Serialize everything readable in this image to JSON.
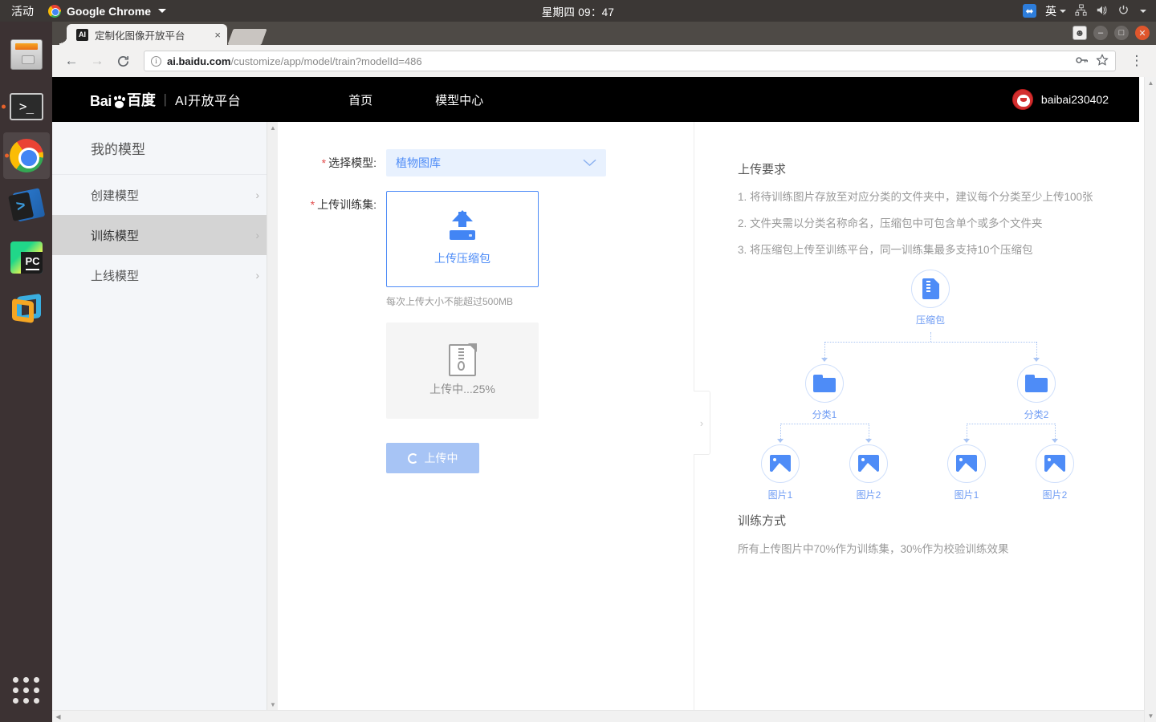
{
  "os_topbar": {
    "activities": "活动",
    "app_name": "Google Chrome",
    "clock": "星期四 09：47",
    "ime": "英",
    "icons": [
      "dropbox-icon",
      "network-icon",
      "volume-muted-icon",
      "power-icon"
    ]
  },
  "dock": {
    "items": [
      {
        "name": "files",
        "icon": "files-icon"
      },
      {
        "name": "terminal",
        "icon": "terminal-icon"
      },
      {
        "name": "chrome",
        "icon": "chrome-icon"
      },
      {
        "name": "vscode",
        "icon": "vscode-icon"
      },
      {
        "name": "pycharm",
        "icon": "pycharm-icon"
      },
      {
        "name": "virtualbox",
        "icon": "virtualbox-icon"
      }
    ],
    "show_apps": "show-applications-icon"
  },
  "browser": {
    "tab": {
      "favicon_text": "AI",
      "title": "定制化图像开放平台",
      "close": "×"
    },
    "url_host": "ai.baidu.com",
    "url_path": "/customize/app/model/train?modelId=486",
    "back": "←",
    "forward": "→",
    "reload": "C",
    "key_icon": "password-key-icon",
    "star_icon": "bookmark-star-icon",
    "menu_icon": "chrome-menu-icon",
    "window_buttons": {
      "minimize": "–",
      "maximize": "□",
      "close": "✕"
    }
  },
  "site": {
    "brand_baidu": "Bai",
    "brand_baidu_cn": "百度",
    "brand_sep": "|",
    "brand_sub": "AI开放平台",
    "nav": [
      {
        "label": "首页"
      },
      {
        "label": "模型中心"
      }
    ],
    "user": "baibai230402"
  },
  "sidebar": {
    "title": "我的模型",
    "items": [
      {
        "label": "创建模型",
        "chevron": "›",
        "active": false
      },
      {
        "label": "训练模型",
        "chevron": "›",
        "active": true
      },
      {
        "label": "上线模型",
        "chevron": "›",
        "active": false
      }
    ]
  },
  "form": {
    "model_label": "选择模型:",
    "model_required": "*",
    "model_value": "植物图库",
    "model_chevron": "⌄",
    "upload_label": "上传训练集:",
    "upload_required": "*",
    "upload_box_text": "上传压缩包",
    "upload_hint": "每次上传大小不能超过500MB",
    "file_status": "上传中...25%",
    "submit_button": "上传中",
    "collapse_chevron": "›"
  },
  "requirements": {
    "heading": "上传要求",
    "items": [
      "1. 将待训练图片存放至对应分类的文件夹中，建议每个分类至少上传100张",
      "2. 文件夹需以分类名称命名，压缩包中可包含单个或多个文件夹",
      "3. 将压缩包上传至训练平台，同一训练集最多支持10个压缩包"
    ],
    "tree": {
      "root": {
        "label": "压缩包",
        "icon": "zip-file-icon"
      },
      "folders": [
        {
          "label": "分类1",
          "icon": "folder-icon"
        },
        {
          "label": "分类2",
          "icon": "folder-icon"
        }
      ],
      "images": [
        {
          "label": "图片1",
          "icon": "image-icon"
        },
        {
          "label": "图片2",
          "icon": "image-icon"
        },
        {
          "label": "图片1",
          "icon": "image-icon"
        },
        {
          "label": "图片2",
          "icon": "image-icon"
        }
      ]
    }
  },
  "training": {
    "heading": "训练方式",
    "text": "所有上传图片中70%作为训练集，30%作为校验训练效果"
  },
  "colors": {
    "brand_blue": "#4e8cf7",
    "select_bg": "#e8f1fe",
    "button_disabled": "#a7c4f5",
    "required_red": "#e24c4c",
    "header_black": "#000000"
  }
}
